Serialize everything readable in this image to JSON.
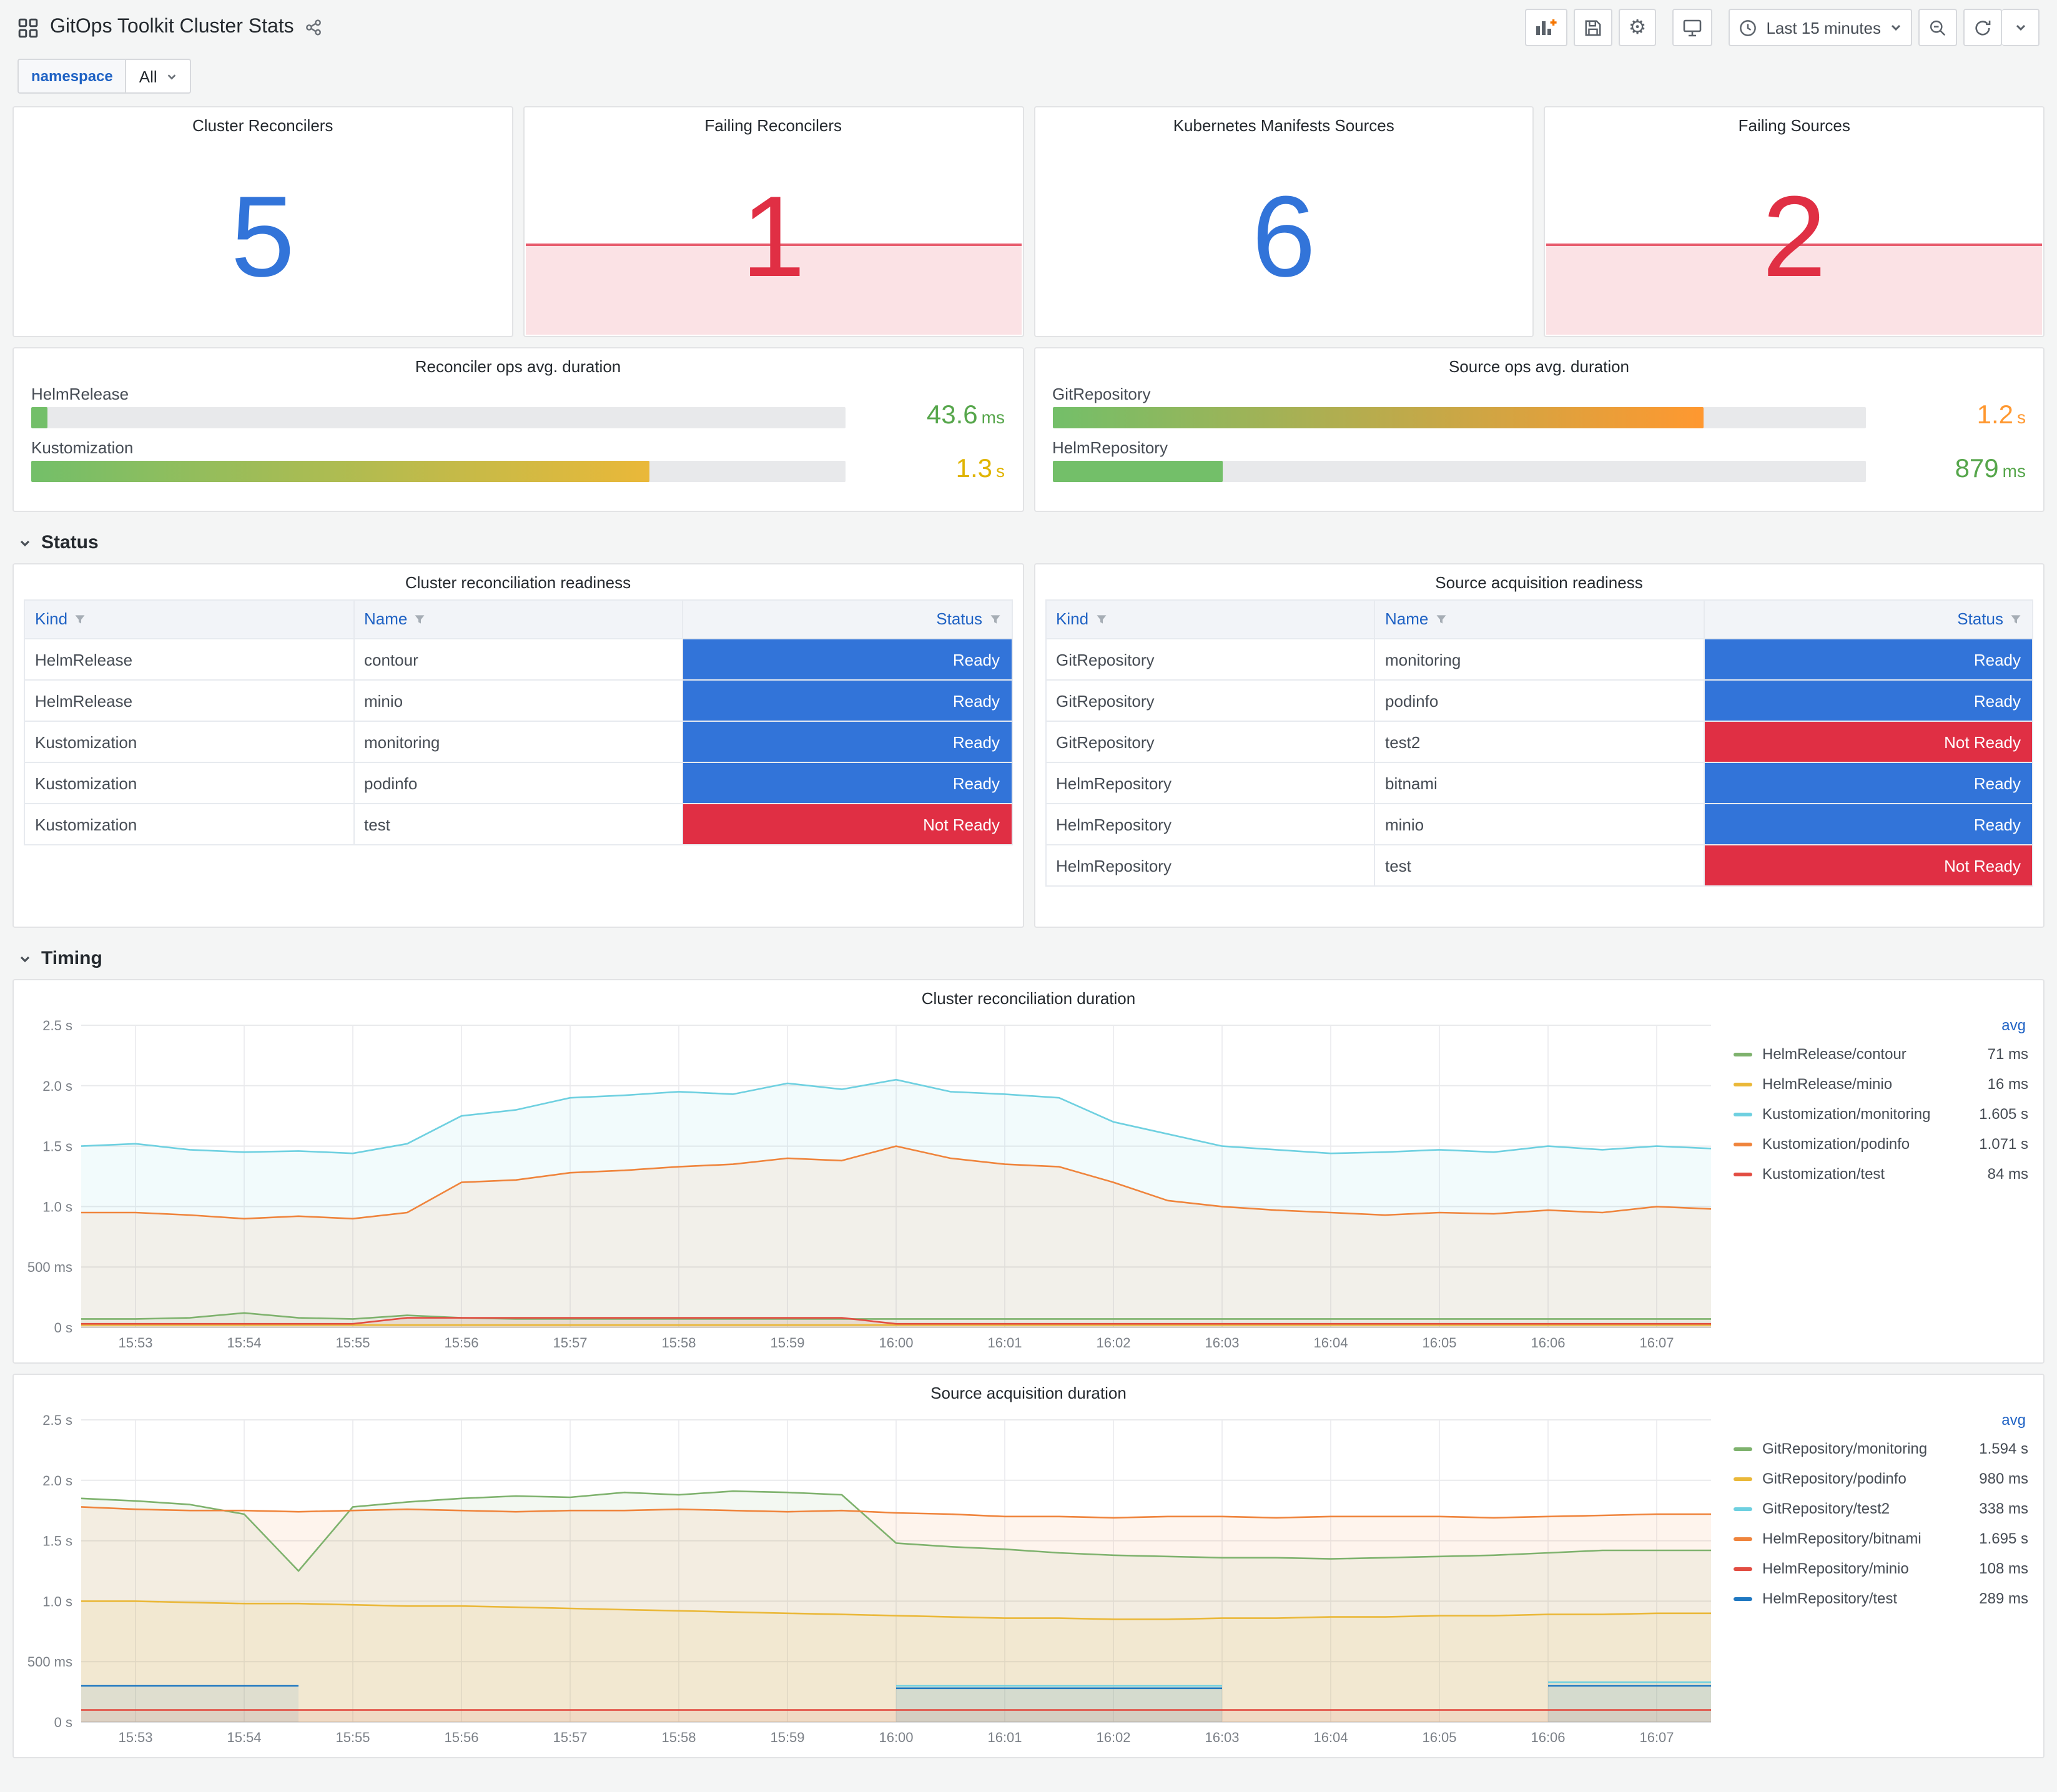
{
  "header": {
    "title": "GitOps Toolkit Cluster Stats",
    "time_range": "Last 15 minutes",
    "toolbar_icons": [
      "add-panel",
      "save-dashboard",
      "dashboard-settings",
      "cycle-view-mode",
      "time-picker",
      "zoom-out-time-range",
      "refresh",
      "refresh-interval"
    ]
  },
  "variables": {
    "label": "namespace",
    "value": "All"
  },
  "stats": [
    {
      "title": "Cluster Reconcilers",
      "value": "5",
      "color": "#3274d9",
      "alert": false
    },
    {
      "title": "Failing Reconcilers",
      "value": "1",
      "color": "#e02f44",
      "alert": true
    },
    {
      "title": "Kubernetes Manifests Sources",
      "value": "6",
      "color": "#3274d9",
      "alert": false
    },
    {
      "title": "Failing Sources",
      "value": "2",
      "color": "#e02f44",
      "alert": true
    }
  ],
  "gauges": [
    {
      "title": "Reconciler ops avg. duration",
      "rows": [
        {
          "label": "HelmRelease",
          "value": "43.6",
          "unit": "ms",
          "value_color": "#56a64b",
          "percent": 2,
          "bar_from": "#73bf69",
          "bar_to": "#73bf69"
        },
        {
          "label": "Kustomization",
          "value": "1.3",
          "unit": "s",
          "value_color": "#e0b400",
          "percent": 76,
          "bar_from": "#73bf69",
          "bar_to": "#eab839"
        }
      ]
    },
    {
      "title": "Source ops avg. duration",
      "rows": [
        {
          "label": "GitRepository",
          "value": "1.2",
          "unit": "s",
          "value_color": "#ff9830",
          "percent": 80,
          "bar_from": "#73bf69",
          "bar_to": "#ff9830"
        },
        {
          "label": "HelmRepository",
          "value": "879",
          "unit": "ms",
          "value_color": "#56a64b",
          "percent": 21,
          "bar_from": "#73bf69",
          "bar_to": "#73bf69"
        }
      ]
    }
  ],
  "sections": {
    "status": "Status",
    "timing": "Timing"
  },
  "status_colors": {
    "Ready": "#3274d9",
    "Not Ready": "#e02f44"
  },
  "tables": [
    {
      "title": "Cluster reconciliation readiness",
      "columns": [
        "Kind",
        "Name",
        "Status"
      ],
      "rows": [
        [
          "HelmRelease",
          "contour",
          "Ready"
        ],
        [
          "HelmRelease",
          "minio",
          "Ready"
        ],
        [
          "Kustomization",
          "monitoring",
          "Ready"
        ],
        [
          "Kustomization",
          "podinfo",
          "Ready"
        ],
        [
          "Kustomization",
          "test",
          "Not Ready"
        ]
      ]
    },
    {
      "title": "Source acquisition readiness",
      "columns": [
        "Kind",
        "Name",
        "Status"
      ],
      "rows": [
        [
          "GitRepository",
          "monitoring",
          "Ready"
        ],
        [
          "GitRepository",
          "podinfo",
          "Ready"
        ],
        [
          "GitRepository",
          "test2",
          "Not Ready"
        ],
        [
          "HelmRepository",
          "bitnami",
          "Ready"
        ],
        [
          "HelmRepository",
          "minio",
          "Ready"
        ],
        [
          "HelmRepository",
          "test",
          "Not Ready"
        ]
      ]
    }
  ],
  "chart_data": [
    {
      "type": "line",
      "title": "Cluster reconciliation duration",
      "legend_header": "avg",
      "legend_position": "right",
      "grid": true,
      "ylim": [
        0,
        2.5
      ],
      "yticks": [
        {
          "v": 0,
          "label": "0 s"
        },
        {
          "v": 0.5,
          "label": "500 ms"
        },
        {
          "v": 1,
          "label": "1.0 s"
        },
        {
          "v": 1.5,
          "label": "1.5 s"
        },
        {
          "v": 2,
          "label": "2.0 s"
        },
        {
          "v": 2.5,
          "label": "2.5 s"
        }
      ],
      "x_range": [
        0,
        15
      ],
      "x_step": 0.5,
      "xticks": [
        {
          "v": 0.5,
          "label": "15:53"
        },
        {
          "v": 1.5,
          "label": "15:54"
        },
        {
          "v": 2.5,
          "label": "15:55"
        },
        {
          "v": 3.5,
          "label": "15:56"
        },
        {
          "v": 4.5,
          "label": "15:57"
        },
        {
          "v": 5.5,
          "label": "15:58"
        },
        {
          "v": 6.5,
          "label": "15:59"
        },
        {
          "v": 7.5,
          "label": "16:00"
        },
        {
          "v": 8.5,
          "label": "16:01"
        },
        {
          "v": 9.5,
          "label": "16:02"
        },
        {
          "v": 10.5,
          "label": "16:03"
        },
        {
          "v": 11.5,
          "label": "16:04"
        },
        {
          "v": 12.5,
          "label": "16:05"
        },
        {
          "v": 13.5,
          "label": "16:06"
        },
        {
          "v": 14.5,
          "label": "16:07"
        }
      ],
      "series": [
        {
          "name": "HelmRelease/contour",
          "color": "#7EB26D",
          "avg": "71 ms",
          "values": [
            0.07,
            0.07,
            0.08,
            0.12,
            0.08,
            0.07,
            0.1,
            0.08,
            0.07,
            0.07,
            0.07,
            0.07,
            0.07,
            0.07,
            0.07,
            0.07,
            0.07,
            0.07,
            0.07,
            0.07,
            0.07,
            0.07,
            0.07,
            0.07,
            0.07,
            0.07,
            0.07,
            0.07,
            0.07,
            0.07,
            0.07
          ]
        },
        {
          "name": "HelmRelease/minio",
          "color": "#EAB839",
          "avg": "16 ms",
          "values": [
            0.02,
            0.02,
            0.02,
            0.02,
            0.02,
            0.02,
            0.02,
            0.02,
            0.02,
            0.02,
            0.02,
            0.02,
            0.02,
            0.02,
            0.02,
            0.02,
            0.02,
            0.02,
            0.02,
            0.02,
            0.02,
            0.02,
            0.02,
            0.02,
            0.02,
            0.02,
            0.02,
            0.02,
            0.02,
            0.02,
            0.02
          ]
        },
        {
          "name": "Kustomization/monitoring",
          "color": "#6ED0E0",
          "avg": "1.605 s",
          "values": [
            1.5,
            1.52,
            1.47,
            1.45,
            1.46,
            1.44,
            1.52,
            1.75,
            1.8,
            1.9,
            1.92,
            1.95,
            1.93,
            2.02,
            1.97,
            2.05,
            1.95,
            1.93,
            1.9,
            1.7,
            1.6,
            1.5,
            1.47,
            1.44,
            1.45,
            1.47,
            1.45,
            1.5,
            1.47,
            1.5,
            1.48
          ]
        },
        {
          "name": "Kustomization/podinfo",
          "color": "#EF843C",
          "avg": "1.071 s",
          "values": [
            0.95,
            0.95,
            0.93,
            0.9,
            0.92,
            0.9,
            0.95,
            1.2,
            1.22,
            1.28,
            1.3,
            1.33,
            1.35,
            1.4,
            1.38,
            1.5,
            1.4,
            1.35,
            1.33,
            1.2,
            1.05,
            1.0,
            0.97,
            0.95,
            0.93,
            0.95,
            0.94,
            0.97,
            0.95,
            1.0,
            0.98
          ]
        },
        {
          "name": "Kustomization/test",
          "color": "#E24D42",
          "avg": "84 ms",
          "values": [
            0.03,
            0.03,
            0.03,
            0.03,
            0.03,
            0.03,
            0.08,
            0.08,
            0.08,
            0.08,
            0.08,
            0.08,
            0.08,
            0.08,
            0.08,
            0.03,
            0.03,
            0.03,
            0.03,
            0.03,
            0.03,
            0.03,
            0.03,
            0.03,
            0.03,
            0.03,
            0.03,
            0.03,
            0.03,
            0.03,
            0.03
          ]
        }
      ]
    },
    {
      "type": "line",
      "title": "Source acquisition duration",
      "legend_header": "avg",
      "legend_position": "right",
      "grid": true,
      "ylim": [
        0,
        2.5
      ],
      "yticks": [
        {
          "v": 0,
          "label": "0 s"
        },
        {
          "v": 0.5,
          "label": "500 ms"
        },
        {
          "v": 1,
          "label": "1.0 s"
        },
        {
          "v": 1.5,
          "label": "1.5 s"
        },
        {
          "v": 2,
          "label": "2.0 s"
        },
        {
          "v": 2.5,
          "label": "2.5 s"
        }
      ],
      "x_range": [
        0,
        15
      ],
      "x_step": 0.5,
      "xticks": [
        {
          "v": 0.5,
          "label": "15:53"
        },
        {
          "v": 1.5,
          "label": "15:54"
        },
        {
          "v": 2.5,
          "label": "15:55"
        },
        {
          "v": 3.5,
          "label": "15:56"
        },
        {
          "v": 4.5,
          "label": "15:57"
        },
        {
          "v": 5.5,
          "label": "15:58"
        },
        {
          "v": 6.5,
          "label": "15:59"
        },
        {
          "v": 7.5,
          "label": "16:00"
        },
        {
          "v": 8.5,
          "label": "16:01"
        },
        {
          "v": 9.5,
          "label": "16:02"
        },
        {
          "v": 10.5,
          "label": "16:03"
        },
        {
          "v": 11.5,
          "label": "16:04"
        },
        {
          "v": 12.5,
          "label": "16:05"
        },
        {
          "v": 13.5,
          "label": "16:06"
        },
        {
          "v": 14.5,
          "label": "16:07"
        }
      ],
      "series": [
        {
          "name": "GitRepository/monitoring",
          "color": "#7EB26D",
          "avg": "1.594 s",
          "values": [
            1.85,
            1.83,
            1.8,
            1.72,
            1.25,
            1.78,
            1.82,
            1.85,
            1.87,
            1.86,
            1.9,
            1.88,
            1.91,
            1.9,
            1.88,
            1.48,
            1.45,
            1.43,
            1.4,
            1.38,
            1.37,
            1.36,
            1.36,
            1.35,
            1.36,
            1.37,
            1.38,
            1.4,
            1.42,
            1.42,
            1.42
          ]
        },
        {
          "name": "GitRepository/podinfo",
          "color": "#EAB839",
          "avg": "980 ms",
          "values": [
            1.0,
            1.0,
            0.99,
            0.98,
            0.98,
            0.97,
            0.96,
            0.96,
            0.95,
            0.94,
            0.93,
            0.92,
            0.91,
            0.9,
            0.89,
            0.88,
            0.87,
            0.86,
            0.86,
            0.85,
            0.85,
            0.86,
            0.86,
            0.87,
            0.87,
            0.88,
            0.88,
            0.89,
            0.89,
            0.9,
            0.9
          ]
        },
        {
          "name": "GitRepository/test2",
          "color": "#6ED0E0",
          "avg": "338 ms",
          "values": [
            null,
            null,
            null,
            null,
            null,
            null,
            null,
            null,
            null,
            null,
            null,
            null,
            null,
            null,
            null,
            0.3,
            0.3,
            0.3,
            0.3,
            0.3,
            0.3,
            0.3,
            null,
            null,
            null,
            null,
            null,
            0.33,
            0.33,
            0.33,
            0.33
          ]
        },
        {
          "name": "HelmRepository/bitnami",
          "color": "#EF843C",
          "avg": "1.695 s",
          "values": [
            1.78,
            1.76,
            1.75,
            1.75,
            1.74,
            1.75,
            1.76,
            1.75,
            1.74,
            1.75,
            1.75,
            1.76,
            1.75,
            1.74,
            1.75,
            1.73,
            1.72,
            1.7,
            1.7,
            1.69,
            1.7,
            1.7,
            1.69,
            1.7,
            1.7,
            1.7,
            1.69,
            1.7,
            1.71,
            1.72,
            1.72
          ]
        },
        {
          "name": "HelmRepository/minio",
          "color": "#E24D42",
          "avg": "108 ms",
          "values": [
            0.1,
            0.1,
            0.1,
            0.1,
            0.1,
            0.1,
            0.1,
            0.1,
            0.1,
            0.1,
            0.1,
            0.1,
            0.1,
            0.1,
            0.1,
            0.1,
            0.1,
            0.1,
            0.1,
            0.1,
            0.1,
            0.1,
            0.1,
            0.1,
            0.1,
            0.1,
            0.1,
            0.1,
            0.1,
            0.1,
            0.1
          ]
        },
        {
          "name": "HelmRepository/test",
          "color": "#1F78C1",
          "avg": "289 ms",
          "values": [
            0.3,
            0.3,
            0.3,
            0.3,
            0.3,
            null,
            null,
            null,
            null,
            null,
            null,
            null,
            null,
            null,
            null,
            0.28,
            0.28,
            0.28,
            0.28,
            0.28,
            0.28,
            0.28,
            null,
            null,
            null,
            null,
            null,
            0.3,
            0.3,
            0.3,
            0.3
          ]
        }
      ]
    }
  ]
}
